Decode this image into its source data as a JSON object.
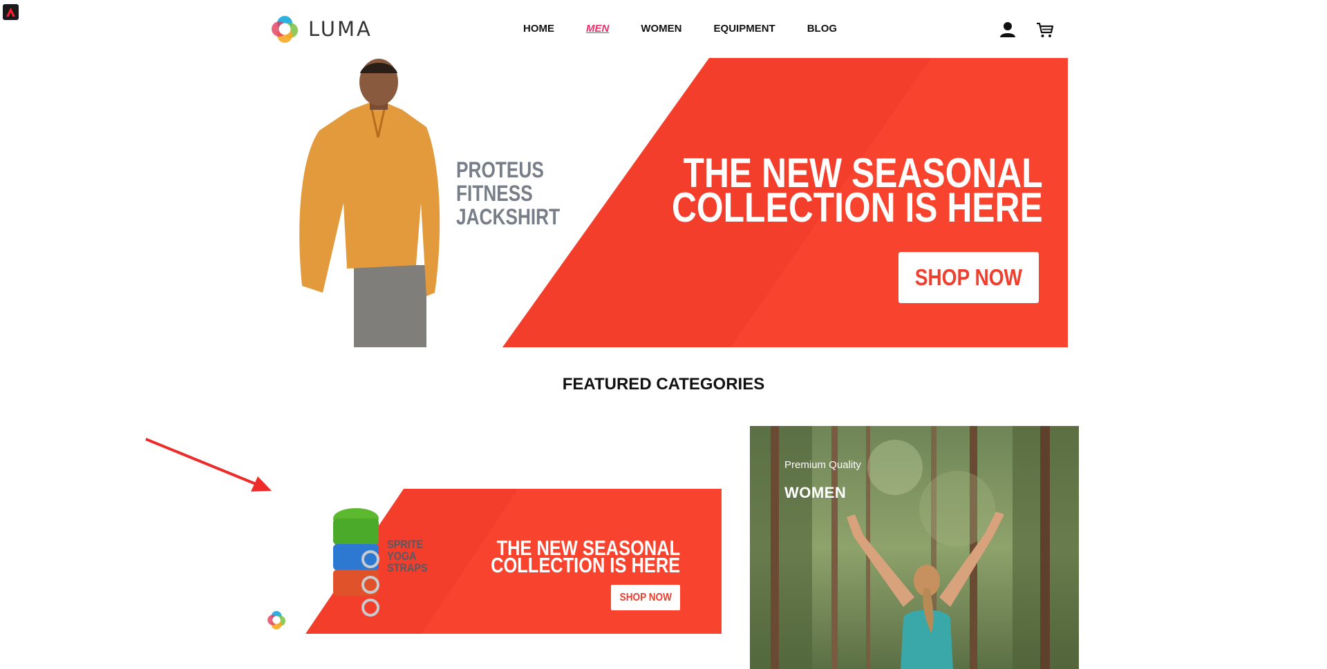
{
  "brand": {
    "name": "LUMA"
  },
  "nav": {
    "items": [
      {
        "label": "HOME",
        "active": false
      },
      {
        "label": "MEN",
        "active": true
      },
      {
        "label": "WOMEN",
        "active": false
      },
      {
        "label": "EQUIPMENT",
        "active": false
      },
      {
        "label": "BLOG",
        "active": false
      }
    ]
  },
  "header_icons": [
    "user-icon",
    "cart-icon"
  ],
  "hero": {
    "product_lines": [
      "PROTEUS",
      "FITNESS",
      "JACKSHIRT"
    ],
    "headline_lines": [
      "THE NEW SEASONAL",
      "COLLECTION IS HERE"
    ],
    "cta": "SHOP NOW",
    "accent_color": "#f43e2c"
  },
  "featured": {
    "title": "FEATURED CATEGORIES"
  },
  "promo": {
    "product_lines": [
      "SPRITE",
      "YOGA",
      "STRAPS"
    ],
    "headline_lines": [
      "THE NEW SEASONAL",
      "COLLECTION IS HERE"
    ],
    "cta": "SHOP NOW"
  },
  "women_card": {
    "subtitle": "Premium Quality",
    "title": "WOMEN"
  },
  "colors": {
    "nav_active": "#e8336a",
    "promo_red": "#f43e2c",
    "annotation_arrow": "#ee2b2b"
  }
}
